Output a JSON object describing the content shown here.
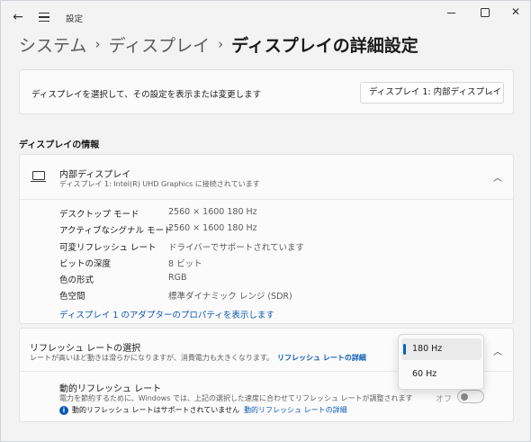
{
  "window": {
    "title": "設定"
  },
  "breadcrumb": {
    "items": [
      "システム",
      "ディスプレイ"
    ],
    "current": "ディスプレイの詳細設定",
    "separator": "›"
  },
  "display_select": {
    "label": "ディスプレイを選択して、その設定を表示または変更します",
    "selected": "ディスプレイ 1: 内部ディスプレイ"
  },
  "section_title": "ディスプレイの情報",
  "display_info": {
    "title": "内部ディスプレイ",
    "subtitle": "ディスプレイ 1: Intel(R) UHD Graphics に接続されています",
    "rows": [
      {
        "label": "デスクトップ モード",
        "value": "2560 × 1600 180 Hz"
      },
      {
        "label": "アクティブなシグナル モード",
        "value": "2560 × 1600 180 Hz"
      },
      {
        "label": "可変リフレッシュ レート",
        "value": "ドライバーでサポートされています"
      },
      {
        "label": "ビットの深度",
        "value": "8 ビット"
      },
      {
        "label": "色の形式",
        "value": "RGB"
      },
      {
        "label": "色空間",
        "value": "標準ダイナミック レンジ (SDR)"
      }
    ],
    "adapter_link": "ディスプレイ 1 のアダプターのプロパティを表示します"
  },
  "refresh": {
    "title": "リフレッシュ レートの選択",
    "description": "レートが高いほど動きは滑らかになりますが、消費電力も大きくなります。",
    "details_link": "リフレッシュ レートの詳細",
    "options": [
      "180 Hz",
      "60 Hz"
    ],
    "selected": "180 Hz"
  },
  "dynamic_refresh": {
    "title": "動的リフレッシュ レート",
    "description": "電力を節約するために、Windows では、上記の選択した速度に合わせてリフレッシュ レートが調整されます",
    "note": "動的リフレッシュ レートはサポートされていません",
    "note_link": "動的リフレッシュ レートの詳細",
    "toggle_label": "オフ",
    "toggle_on": false
  },
  "colors": {
    "accent": "#0a5fc7",
    "link": "#0a58b4",
    "background": "#f3f3f3"
  }
}
